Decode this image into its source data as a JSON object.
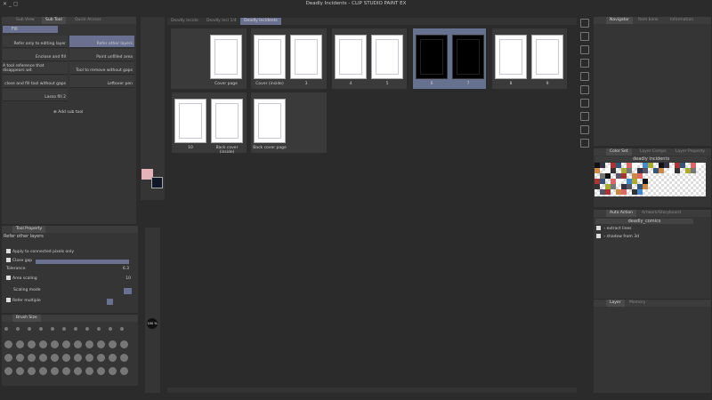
{
  "window": {
    "title": "Deadly Incidents - CLIP STUDIO PAINT EX"
  },
  "left_tabs": [
    "Sub View",
    "Sub Tool",
    "Quick Access"
  ],
  "subtool": {
    "group": "Fill",
    "left": [
      "Refer only to editing layer",
      "Enclose and fill",
      "A tool reference that disappears wit",
      "close and fill tool without gaps",
      "Lasso fill 2"
    ],
    "right": [
      "Refer other layers",
      "Paint unfilled area",
      "Tool to remove without gaps",
      "Leftover pen"
    ],
    "add": "Add sub tool"
  },
  "tool_property": {
    "title": "Tool Property",
    "subtitle": "Refer other layers",
    "apply": "Apply to connected pixels only",
    "close_gap": "Close gap",
    "tolerance": "Tolerance",
    "tolerance_val": "6.3",
    "area_scaling": "Area scaling",
    "area_val": "10",
    "scaling_mode": "Scaling mode",
    "refer_multiple": "Refer multiple"
  },
  "brush_size": {
    "title": "Brush Size",
    "zoom": "100 %"
  },
  "doc_tabs": [
    "Deadly Incide",
    "Deadly Inci 1/4",
    "Deadly Incidents"
  ],
  "pages": [
    {
      "labels": [
        "Cover page"
      ]
    },
    {
      "labels": [
        "Cover (inside)",
        "3"
      ]
    },
    {
      "labels": [
        "4",
        "5"
      ]
    },
    {
      "labels": [
        "6",
        "7"
      ],
      "selected": true
    },
    {
      "labels": [
        "8",
        "9"
      ]
    },
    {
      "labels": [
        "10",
        "Back cover (inside)"
      ]
    },
    {
      "labels": [
        "Back cover page"
      ]
    }
  ],
  "right_tabs": {
    "nav": [
      "Navigator",
      "Item bank",
      "Information"
    ],
    "color": [
      "Color Set",
      "Layer Comps",
      "Layer Property"
    ],
    "auto": [
      "Auto Action",
      "Artwork/Storyboard"
    ],
    "layer": [
      "Layer",
      "Memory"
    ]
  },
  "color_set": {
    "name": "deadly incidents"
  },
  "auto_action": {
    "set": "deadly_comics",
    "items": [
      "extract lines",
      "shadow from 3d"
    ]
  },
  "colors": {
    "accent": "#6a7090",
    "fg": "#e7b3bb",
    "bg": "#101828"
  }
}
